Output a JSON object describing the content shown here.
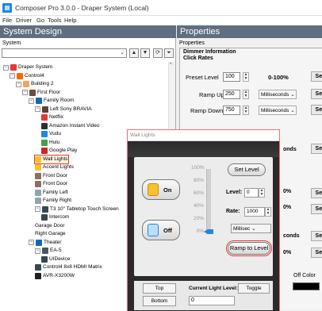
{
  "window": {
    "title": "Composer Pro 3.0.0 - Draper System (Local)"
  },
  "menu": [
    "File",
    "Driver",
    "Go",
    "Tools",
    "Help"
  ],
  "left": {
    "header": "System Design",
    "system_label": "System",
    "combo_value": ""
  },
  "tree": [
    {
      "label": "Draper System",
      "depth": 0,
      "icon": "project-icon",
      "color": "#e53935",
      "expand": "−"
    },
    {
      "label": "Control4",
      "depth": 1,
      "icon": "controller-icon",
      "color": "#ef6c00",
      "expand": "−"
    },
    {
      "label": "Building 2",
      "depth": 2,
      "icon": "building-icon",
      "color": "#f4a261",
      "expand": "−"
    },
    {
      "label": "First Floor",
      "depth": 3,
      "icon": "floor-icon",
      "color": "#6d4c41",
      "expand": "−"
    },
    {
      "label": "Family Room",
      "depth": 4,
      "icon": "room-icon",
      "color": "#1565c0",
      "expand": "−"
    },
    {
      "label": "Left Sony BRAVIA",
      "depth": 5,
      "icon": "tv-icon",
      "color": "#5d4037",
      "expand": "−"
    },
    {
      "label": "Netflix",
      "depth": 6,
      "icon": "app-icon",
      "color": "#e53935"
    },
    {
      "label": "Amazon Instant Video",
      "depth": 6,
      "icon": "app-icon",
      "color": "#263238"
    },
    {
      "label": "Vudu",
      "depth": 6,
      "icon": "app-icon",
      "color": "#1e88e5"
    },
    {
      "label": "Hulu",
      "depth": 6,
      "icon": "app-icon",
      "color": "#43a047"
    },
    {
      "label": "Google Play",
      "depth": 6,
      "icon": "app-icon",
      "color": "#c62828"
    },
    {
      "label": "Wall Lights",
      "depth": 5,
      "icon": "light-icon",
      "color": "#fbc02d",
      "selected": true
    },
    {
      "label": "Accent Lights",
      "depth": 5,
      "icon": "light-icon",
      "color": "#fbc02d"
    },
    {
      "label": "Front Door",
      "depth": 5,
      "icon": "lock-icon",
      "color": "#8d6e63"
    },
    {
      "label": "Front Door",
      "depth": 5,
      "icon": "lock-icon",
      "color": "#8d6e63"
    },
    {
      "label": "Family Left",
      "depth": 5,
      "icon": "shade-icon",
      "color": "#90a4ae"
    },
    {
      "label": "Family Right",
      "depth": 5,
      "icon": "shade-icon",
      "color": "#90a4ae"
    },
    {
      "label": "T3 10\" Tabletop Touch Screen",
      "depth": 5,
      "icon": "touchscreen-icon",
      "color": "#37474f",
      "expand": "−"
    },
    {
      "label": "Intercom",
      "depth": 6,
      "icon": "intercom-icon",
      "color": "#37474f"
    },
    {
      "label": "Garage Door",
      "depth": 5,
      "icon": "blank-icon",
      "color": ""
    },
    {
      "label": "Right Garage",
      "depth": 5,
      "icon": "blank-icon",
      "color": ""
    },
    {
      "label": "Theater",
      "depth": 4,
      "icon": "room-icon",
      "color": "#1565c0",
      "expand": "−"
    },
    {
      "label": "EA-5",
      "depth": 5,
      "icon": "controller-icon",
      "color": "#455a64",
      "expand": "−"
    },
    {
      "label": "UIDevice",
      "depth": 6,
      "icon": "device-icon",
      "color": "#37474f"
    },
    {
      "label": "Control4 8x8 HDMI Matrix",
      "depth": 5,
      "icon": "matrix-icon",
      "color": "#37474f"
    },
    {
      "label": "AVR-X3200W",
      "depth": 5,
      "icon": "receiver-icon",
      "color": "#212121"
    }
  ],
  "right": {
    "header": "Properties",
    "props_label": "Properties",
    "group_title": "Dimmer Information",
    "sub_title": "Click Rates",
    "preset": {
      "label": "Preset Level",
      "value": "100",
      "range": "0-100%",
      "set": "Set"
    },
    "ramp_up": {
      "label": "Ramp Up",
      "value": "250",
      "unit": "Milliseconds",
      "set": "Set"
    },
    "ramp_down": {
      "label": "Ramp Down",
      "value": "750",
      "unit": "Milliseconds",
      "set": "Set"
    },
    "partials": [
      "onds",
      "0%",
      "0%",
      "conds",
      "0%"
    ],
    "set_labels": [
      "Set",
      "Set",
      "Set",
      "Set",
      "Set"
    ],
    "off_color": "Off Color"
  },
  "dialog": {
    "title": "Wall Lights",
    "on_label": "On",
    "off_label": "Off",
    "scale": [
      "100%",
      "80%",
      "60%",
      "40%",
      "20%",
      "0%"
    ],
    "level_percent": 0,
    "set_level_label": "Set Level",
    "level_label": "Level:",
    "level_value": "0",
    "rate_label": "Rate:",
    "rate_value": "1000",
    "rate_unit": "Millisec",
    "ramp_label": "Ramp to Level",
    "top_label": "Top",
    "bottom_label": "Bottom",
    "current_label": "Current Light Level:",
    "current_value": "0",
    "toggle_label": "Toggle"
  }
}
